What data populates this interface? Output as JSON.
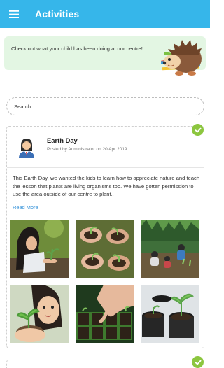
{
  "appbar": {
    "title": "Activities",
    "menu_icon": "hamburger-menu-icon",
    "color": "#36b6ea"
  },
  "banner": {
    "text": "Check out what your child has been doing at our centre!",
    "background": "#e3f6e3"
  },
  "search": {
    "label": "Search:",
    "value": "",
    "placeholder": ""
  },
  "posts": [
    {
      "title": "Earth Day",
      "meta": "Posted by Administrator on 20 Apr 2019",
      "body": "This Earth Day, we wanted the kids to learn how to appreciate nature and teach the lesson that plants are living organisms too. We have gotten permission to use the area outside of our centre to plant..",
      "read_more": "Read More",
      "status_icon": "checkmark-circle-icon",
      "status_color": "#8cc63f",
      "photos": [
        "girl-planting-seedling-photo",
        "hands-holding-soil-photo",
        "children-gardening-outdoors-photo",
        "child-holding-plant-photo",
        "hand-planting-seed-tray-photo",
        "seedlings-in-pots-photo"
      ]
    }
  ]
}
